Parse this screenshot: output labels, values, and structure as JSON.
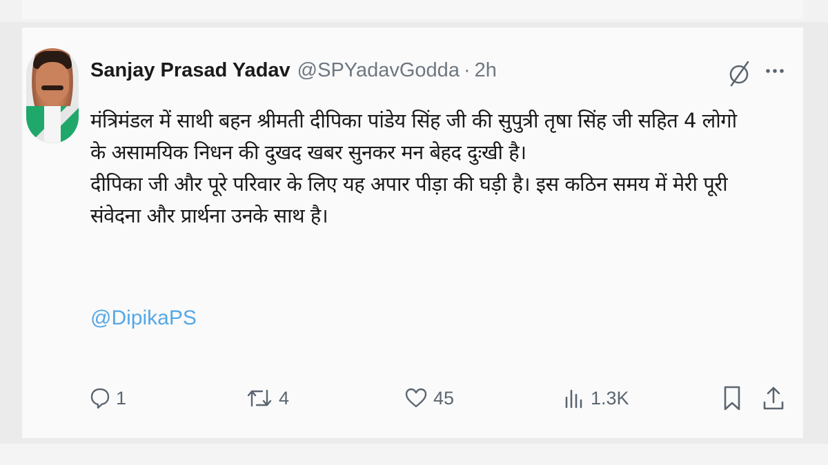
{
  "tweet": {
    "display_name": "Sanjay Prasad Yadav",
    "handle": "@SPYadavGodda",
    "separator": "·",
    "time": "2h",
    "body_lines": [
      "मंत्रिमंडल में साथी बहन श्रीमती दीपिका पांडेय सिंह जी की सुपुत्री तृषा सिंह जी सहित 4 लोगो",
      "के असामयिक निधन की दुखद खबर सुनकर मन बेहद दुःखी है।",
      "दीपिका जी और पूरे परिवार के लिए यह अपार पीड़ा की घड़ी है। इस कठिन समय में मेरी पूरी",
      "संवेदना और प्रार्थना उनके साथ है।"
    ],
    "mention": "@DipikaPS"
  },
  "actions": {
    "reply_count": "1",
    "retweet_count": "4",
    "like_count": "45",
    "views_count": "1.3K"
  },
  "icons": {
    "header": [
      "grok-icon",
      "more-icon"
    ],
    "actions": [
      "reply-icon",
      "retweet-icon",
      "like-icon",
      "views-icon",
      "bookmark-icon",
      "share-icon"
    ]
  },
  "colors": {
    "text": "#1a1a1a",
    "secondary": "#6e7780",
    "link": "#54a8e6",
    "background": "#fafafa"
  }
}
